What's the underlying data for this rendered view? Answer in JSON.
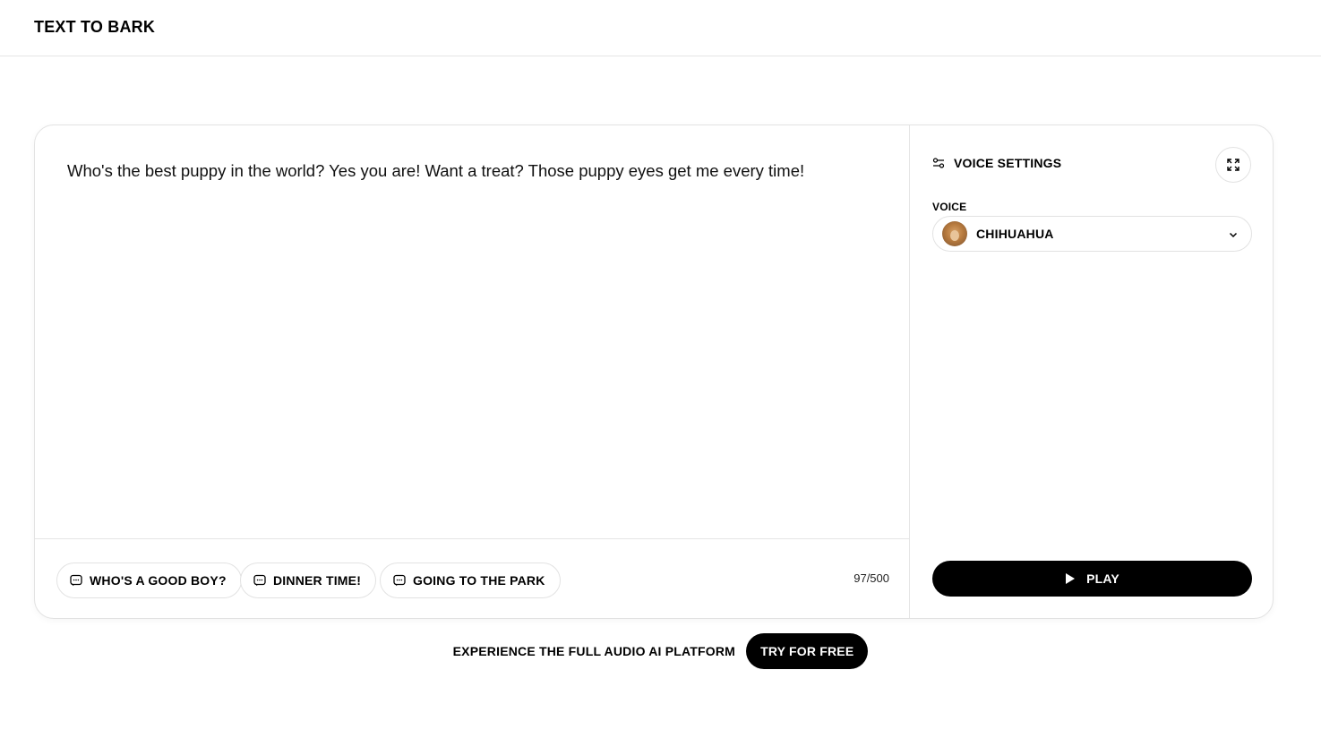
{
  "header": {
    "brand": "TEXT TO BARK"
  },
  "editor": {
    "text": "Who's the best puppy in the world? Yes you are! Want a treat? Those puppy eyes get me every time!",
    "counter": "97/500",
    "presets": [
      {
        "label": "WHO'S A GOOD BOY?",
        "icon": "message-icon"
      },
      {
        "label": "DINNER TIME!",
        "icon": "message-icon"
      },
      {
        "label": "GOING TO THE PARK",
        "icon": "message-icon"
      }
    ]
  },
  "settings": {
    "title": "VOICE SETTINGS",
    "title_icon": "sliders-icon",
    "expand_icon": "expand-icon",
    "voice_label": "VOICE",
    "voice_value": "CHIHUAHUA",
    "play_label": "PLAY"
  },
  "footer": {
    "cta_text": "EXPERIENCE THE FULL AUDIO AI PLATFORM",
    "cta_button": "TRY FOR FREE"
  }
}
